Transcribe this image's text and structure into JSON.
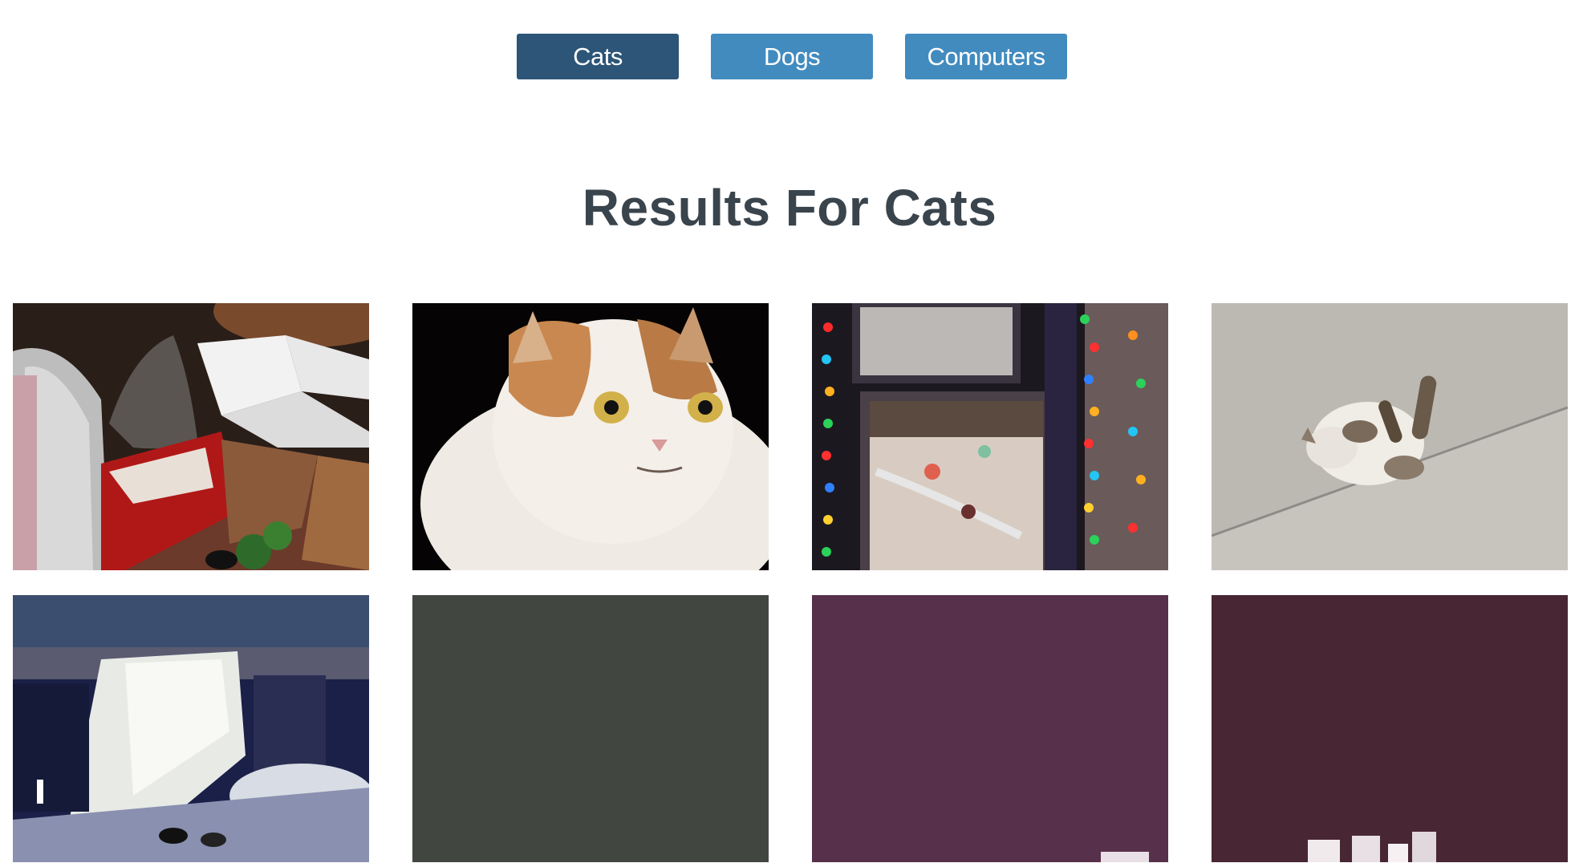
{
  "nav": {
    "buttons": [
      {
        "label": "Cats",
        "active": true
      },
      {
        "label": "Dogs",
        "active": false
      },
      {
        "label": "Computers",
        "active": false
      }
    ]
  },
  "results": {
    "heading": "Results For Cats"
  },
  "colors": {
    "active_button": "#2c5577",
    "inactive_button": "#428bbf",
    "heading_text": "#3a444c"
  },
  "gallery": {
    "tiles": [
      {
        "subject": "cat-among-gift-boxes"
      },
      {
        "subject": "persian-cat-portrait"
      },
      {
        "subject": "window-with-christmas-lights"
      },
      {
        "subject": "cat-rolling-on-pavement"
      },
      {
        "subject": "gif-thumbnail-room"
      },
      {
        "subject": "gif-thumbnail-dark-green"
      },
      {
        "subject": "gif-thumbnail-purple"
      },
      {
        "subject": "gif-thumbnail-maroon"
      }
    ]
  }
}
